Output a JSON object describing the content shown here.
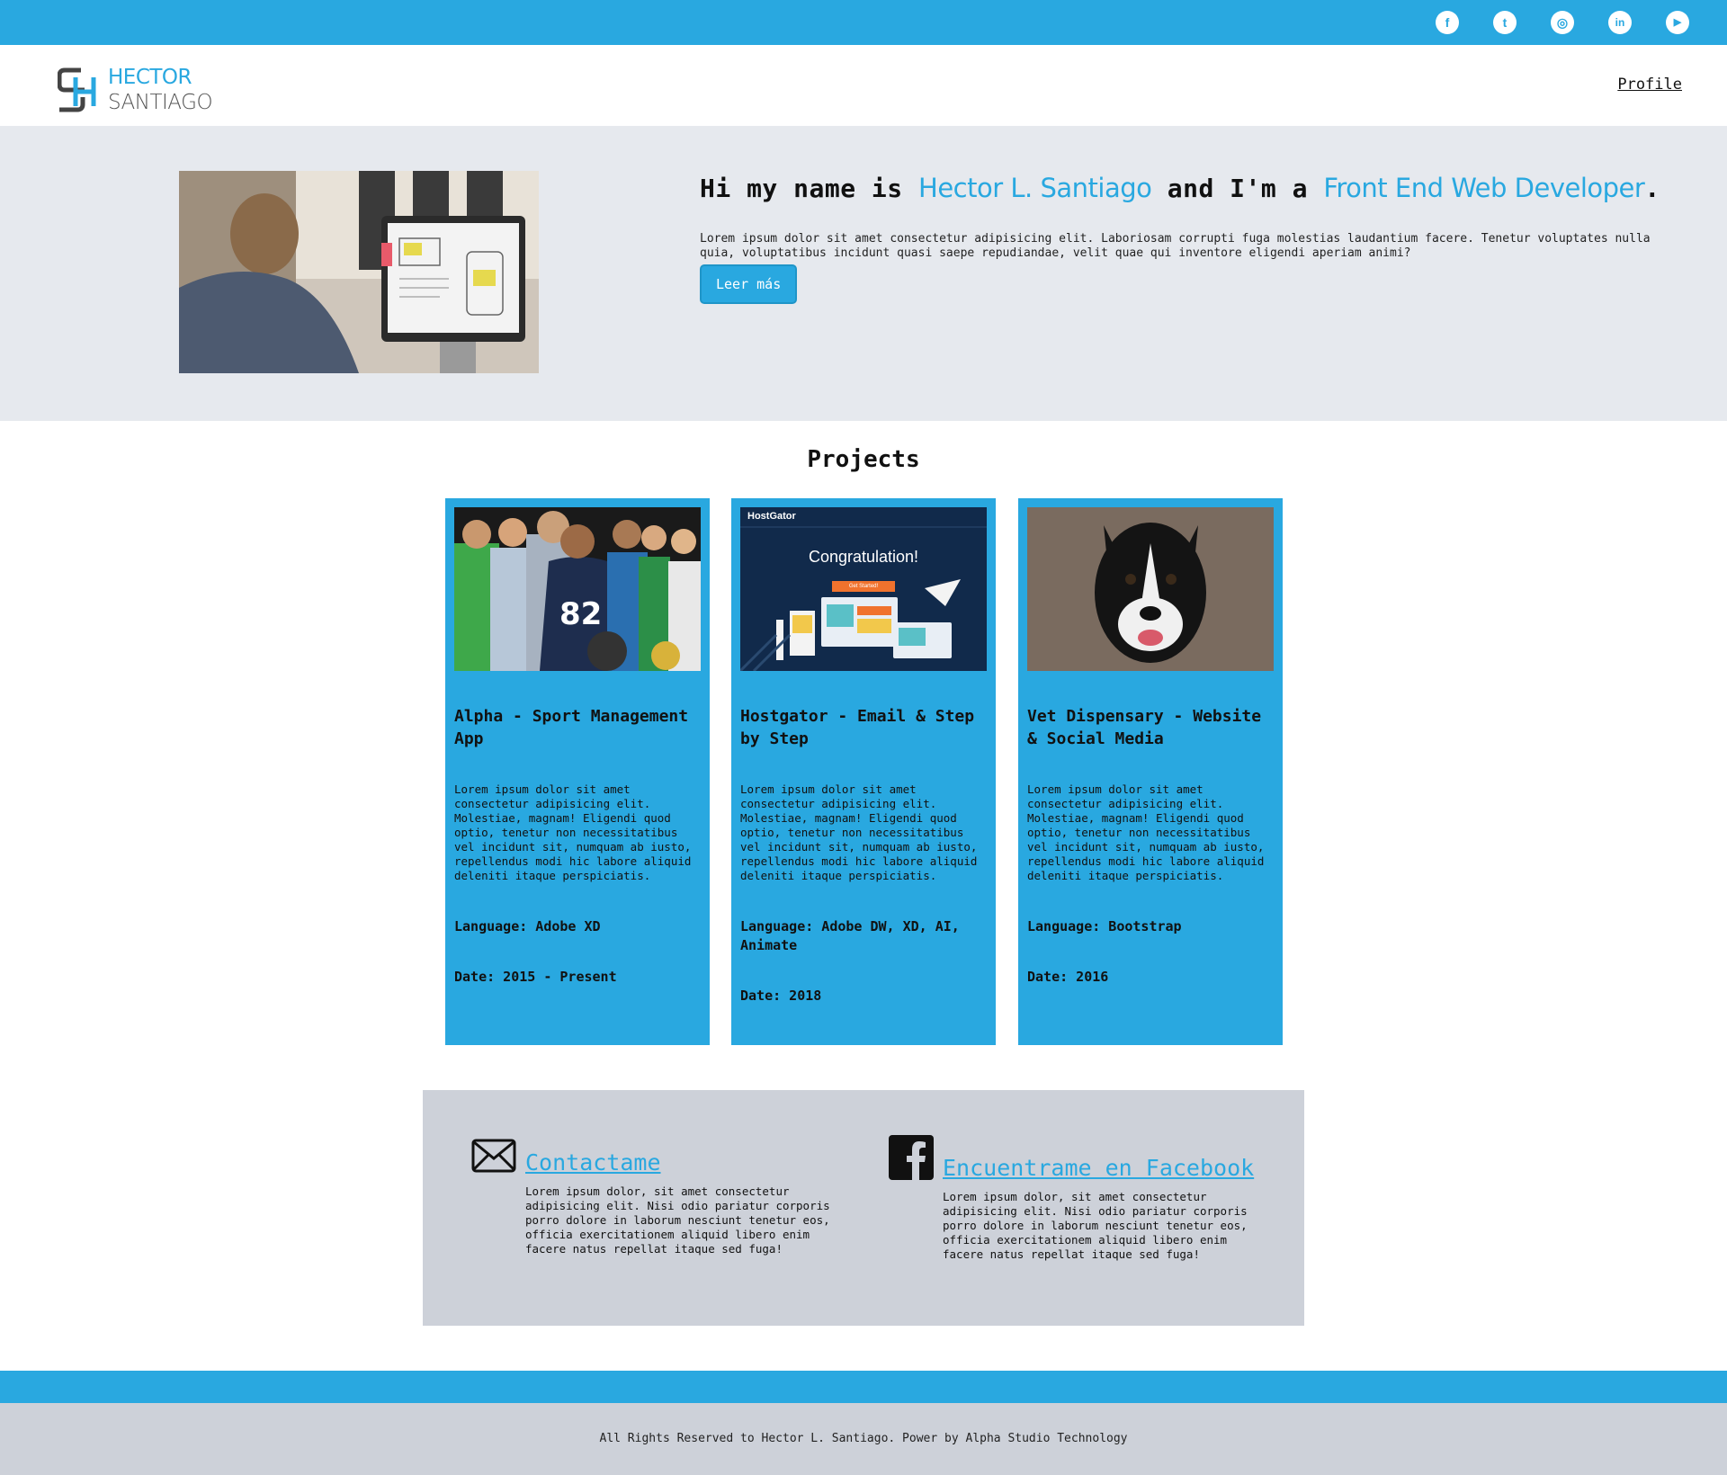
{
  "social": {
    "items": [
      {
        "name": "facebook-icon",
        "glyph": "f"
      },
      {
        "name": "tumblr-icon",
        "glyph": "t"
      },
      {
        "name": "instagram-icon",
        "glyph": "◎"
      },
      {
        "name": "linkedin-icon",
        "glyph": "in"
      },
      {
        "name": "youtube-icon",
        "glyph": "▶"
      }
    ]
  },
  "header": {
    "logo_first": "HECTOR",
    "logo_last": "SANTIAGO",
    "nav_profile": "Profile"
  },
  "hero": {
    "heading_1": "Hi my name is ",
    "name": "Hector L. Santiago",
    "heading_2": " and I'm a ",
    "role": "Front End Web Developer",
    "heading_3": ".",
    "paragraph": "Lorem ipsum dolor sit amet consectetur adipisicing elit. Laboriosam corrupti fuga molestias laudantium facere. Tenetur voluptates nulla quia, voluptatibus incidunt quasi saepe repudiandae, velit quae qui inventore eligendi aperiam animi?",
    "button": "Leer más"
  },
  "projects": {
    "title": "Projects",
    "cards": [
      {
        "title": "Alpha - Sport Management App",
        "desc": "Lorem ipsum dolor sit amet consectetur adipisicing elit. Molestiae, magnam! Eligendi quod optio, tenetur non necessitatibus vel incidunt sit, numquam ab iusto, repellendus modi hic labore aliquid deleniti itaque perspiciatis.",
        "language": "Language: Adobe XD",
        "date": "Date: 2015 - Present"
      },
      {
        "title": "Hostgator - Email & Step by Step",
        "desc": "Lorem ipsum dolor sit amet consectetur adipisicing elit. Molestiae, magnam! Eligendi quod optio, tenetur non necessitatibus vel incidunt sit, numquam ab iusto, repellendus modi hic labore aliquid deleniti itaque perspiciatis.",
        "language": "Language: Adobe DW, XD, AI, Animate",
        "date": "Date: 2018",
        "image_brand": "HostGator",
        "image_headline": "Congratulation!",
        "image_button": "Get Started!"
      },
      {
        "title": "Vet Dispensary - Website & Social Media",
        "desc": "Lorem ipsum dolor sit amet consectetur adipisicing elit. Molestiae, magnam! Eligendi quod optio, tenetur non necessitatibus vel incidunt sit, numquam ab iusto, repellendus modi hic labore aliquid deleniti itaque perspiciatis.",
        "language": "Language: Bootstrap",
        "date": "Date: 2016"
      }
    ]
  },
  "contact": {
    "email_link": "Contactame",
    "email_text": "Lorem ipsum dolor, sit amet consectetur adipisicing elit. Nisi odio pariatur corporis porro dolore in laborum nesciunt tenetur eos, officia exercitationem aliquid libero enim facere natus repellat itaque sed fuga!",
    "facebook_link": "Encuentrame en Facebook",
    "facebook_text": "Lorem ipsum dolor, sit amet consectetur adipisicing elit. Nisi odio pariatur corporis porro dolore in laborum nesciunt tenetur eos, officia exercitationem aliquid libero enim facere natus repellat itaque sed fuga!"
  },
  "footer": {
    "text": "All Rights Reserved to Hector L. Santiago. Power by Alpha Studio Technology"
  },
  "colors": {
    "accent": "#29a8e0",
    "hero_bg": "#e6e9ee",
    "contact_bg": "#cdd1d9"
  }
}
